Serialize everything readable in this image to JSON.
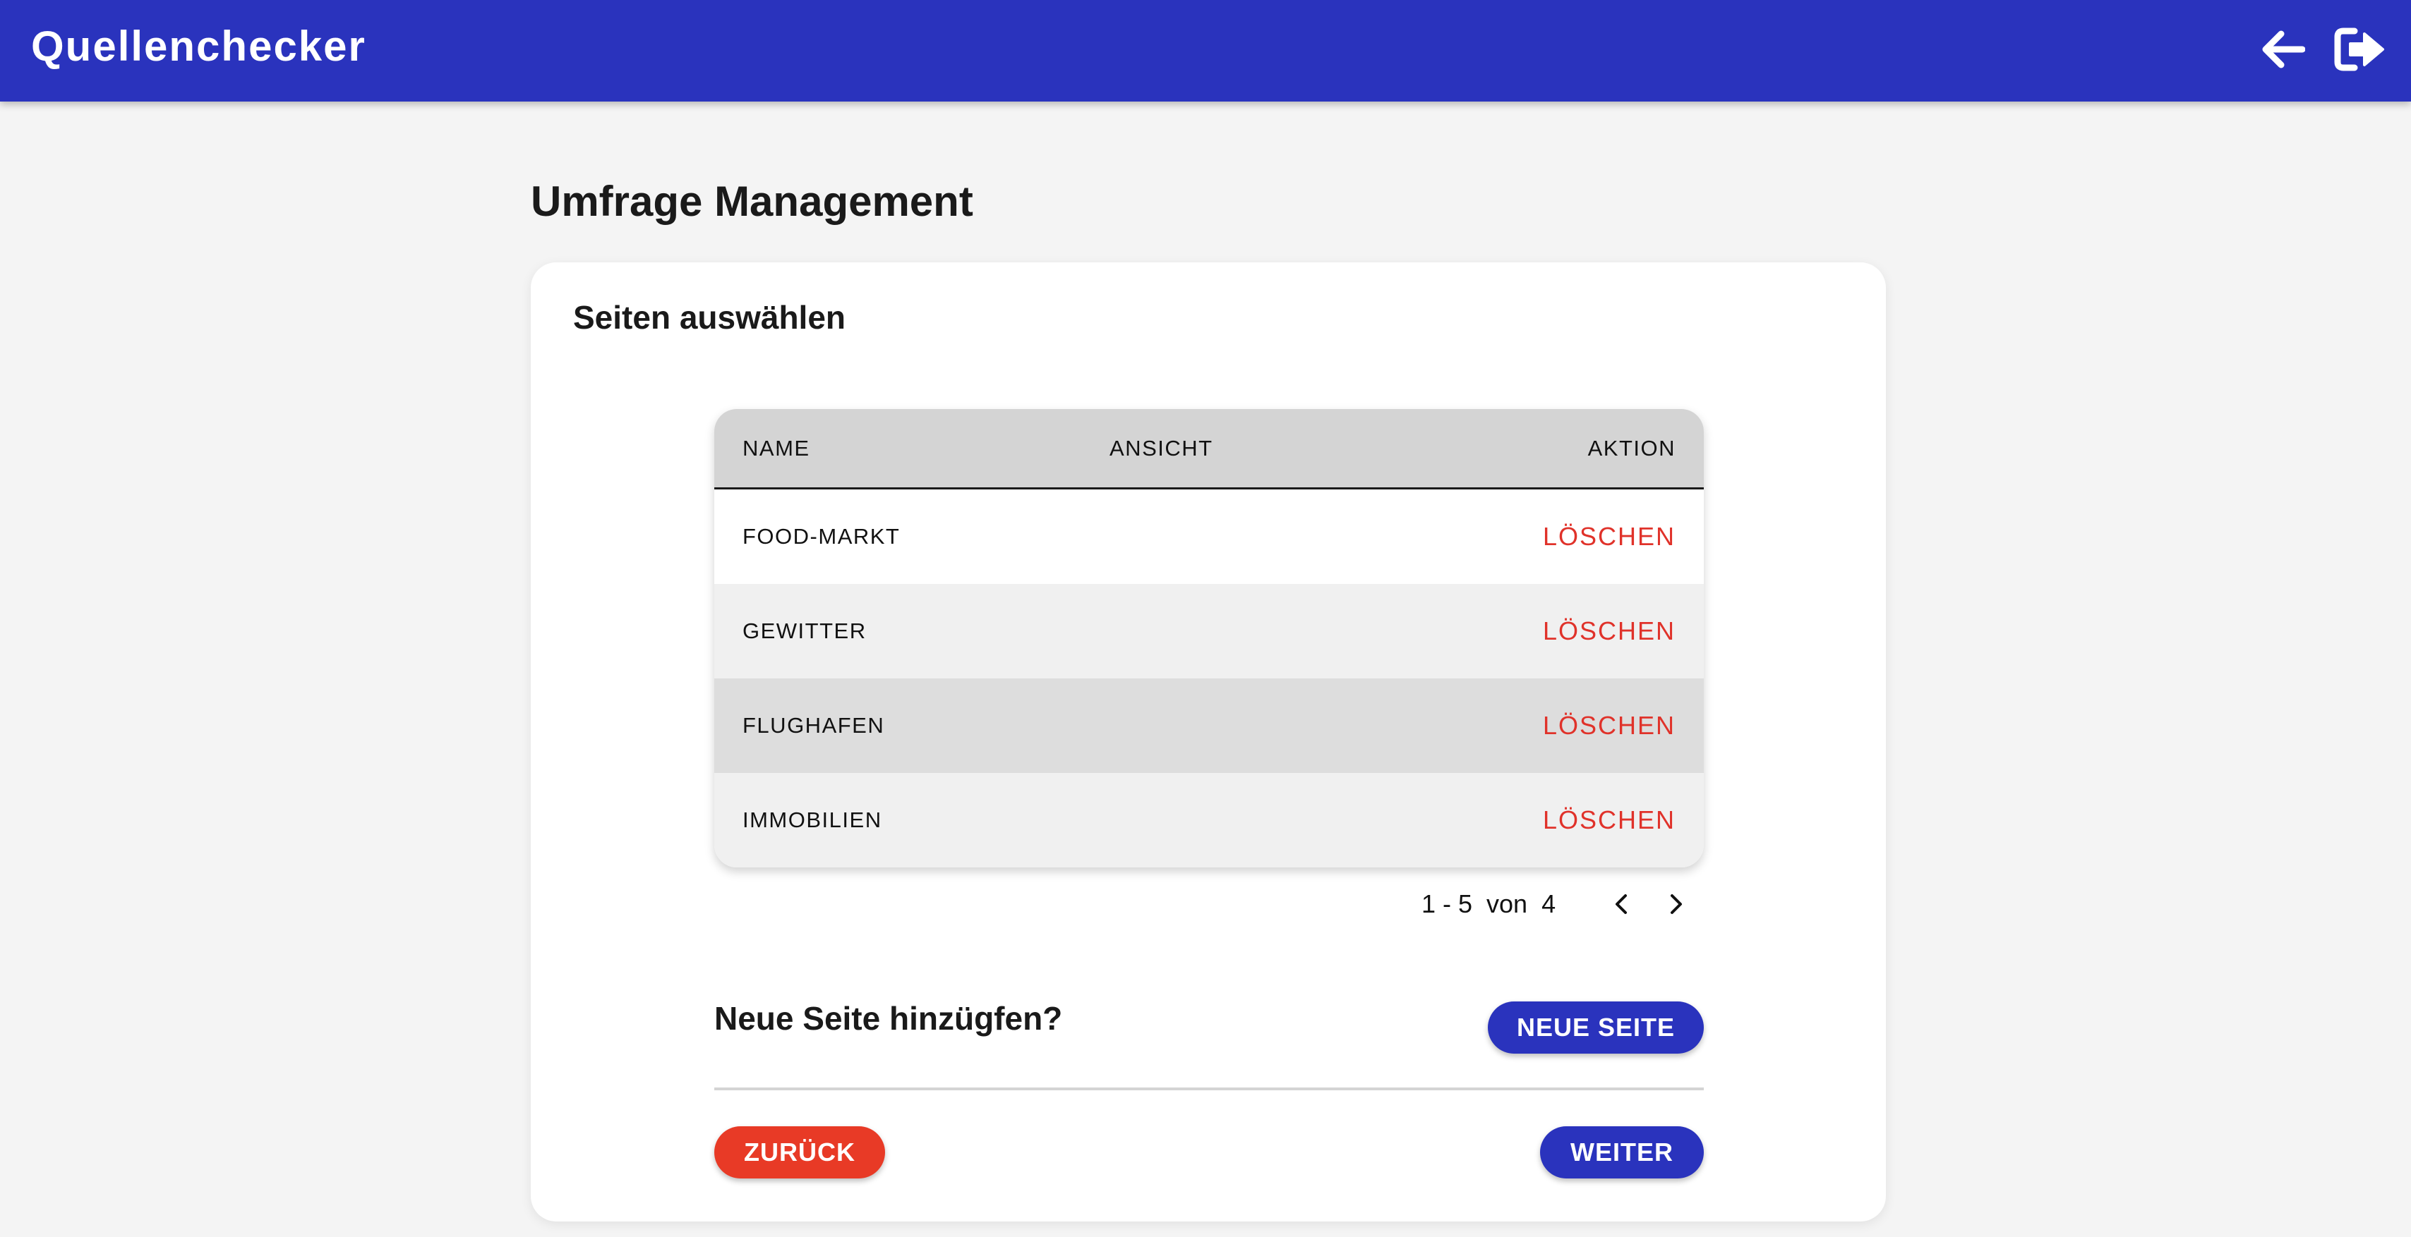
{
  "app": {
    "title": "Quellenchecker"
  },
  "icons": {
    "back": "arrow-left-icon",
    "logout": "logout-icon",
    "prev": "chevron-left-icon",
    "next": "chevron-right-icon"
  },
  "page": {
    "title": "Umfrage Management"
  },
  "card": {
    "title": "Seiten auswählen"
  },
  "table": {
    "headers": {
      "name": "NAME",
      "view": "ANSICHT",
      "action": "AKTION"
    },
    "rows": [
      {
        "name": "FOOD-MARKT",
        "action": "LÖSCHEN"
      },
      {
        "name": "GEWITTER",
        "action": "LÖSCHEN"
      },
      {
        "name": "FLUGHAFEN",
        "action": "LÖSCHEN"
      },
      {
        "name": "IMMOBILIEN",
        "action": "LÖSCHEN"
      }
    ]
  },
  "pagination": {
    "text": "1 - 5  von  4"
  },
  "add_section": {
    "label": "Neue Seite hinzügfen?",
    "button": "NEUE SEITE"
  },
  "footer": {
    "back_button": "ZURÜCK",
    "next_button": "WEITER"
  },
  "colors": {
    "primary": "#2a33bd",
    "danger": "#e83a26",
    "delete_text": "#e0322a",
    "background": "#f4f4f4"
  }
}
